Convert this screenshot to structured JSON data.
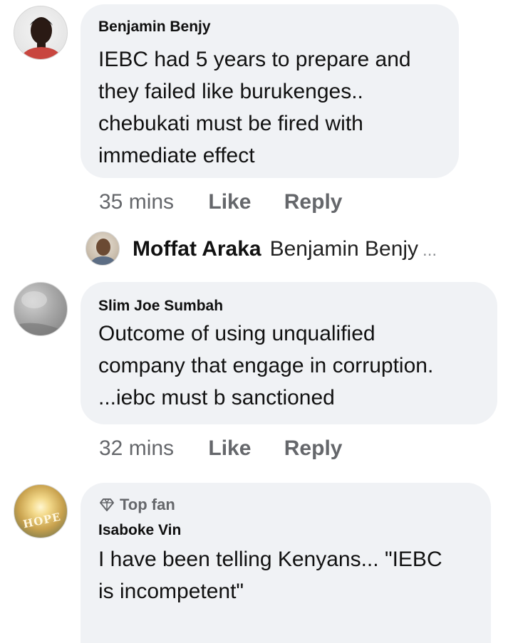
{
  "comments": [
    {
      "author": "Benjamin Benjy",
      "lines": [
        "IEBC had 5 years to prepare and",
        "they failed like burukenges..",
        "chebukati must be fired with",
        "immediate effect"
      ],
      "time": "35 mins",
      "like_label": "Like",
      "reply_label": "Reply",
      "reply_preview": {
        "author": "Moffat Araka",
        "mention": "Benjamin Benjy",
        "ellipsis": "..."
      }
    },
    {
      "author": "Slim Joe Sumbah",
      "lines": [
        "Outcome of using unqualified",
        "company that engage in corruption.",
        "...iebc must b sanctioned"
      ],
      "time": "32 mins",
      "like_label": "Like",
      "reply_label": "Reply"
    },
    {
      "badge": "Top fan",
      "author": "Isaboke Vin",
      "avatar_text": "HOPE",
      "lines": [
        "I have been telling Kenyans... \"IEBC",
        "is incompetent\""
      ]
    }
  ],
  "colors": {
    "bubble_bg": "#f0f2f5",
    "muted_text": "#65676b"
  }
}
